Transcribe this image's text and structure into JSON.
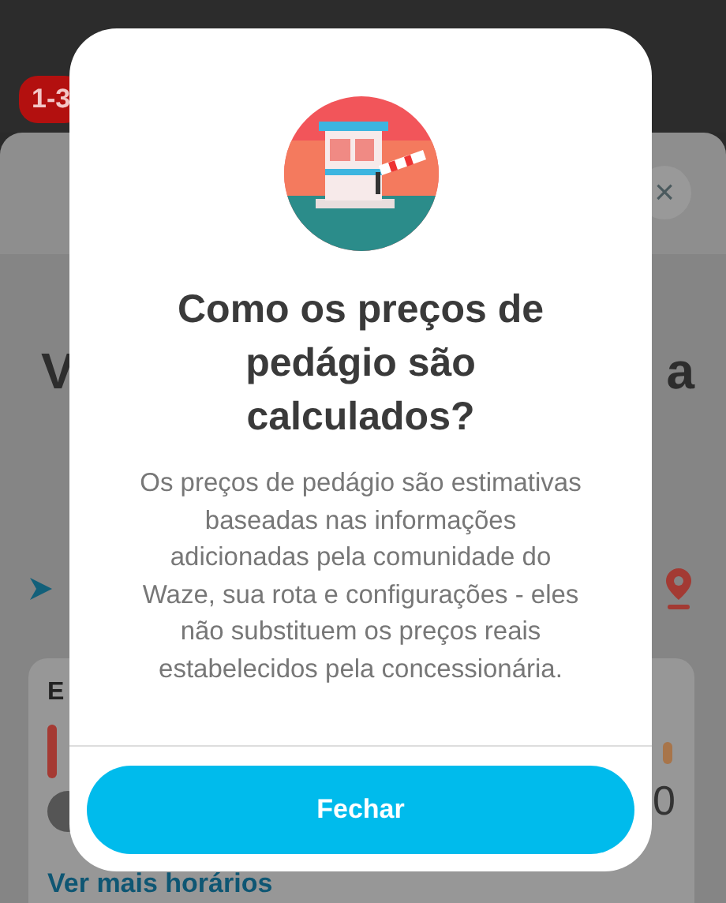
{
  "background": {
    "route_badge": "1-3",
    "close_icon": "×",
    "heading_start": "V",
    "heading_end": "a",
    "card_title": "E",
    "card_value": "0",
    "link": "Ver mais horários"
  },
  "dialog": {
    "title": "Como os preços de pedágio são calculados?",
    "body": "Os preços de pedágio são estimativas baseadas nas informações adicionadas pela comunidade do Waze, sua rota e configurações - eles não substituem os preços reais estabelecidos pela concessionária.",
    "button": "Fechar"
  }
}
